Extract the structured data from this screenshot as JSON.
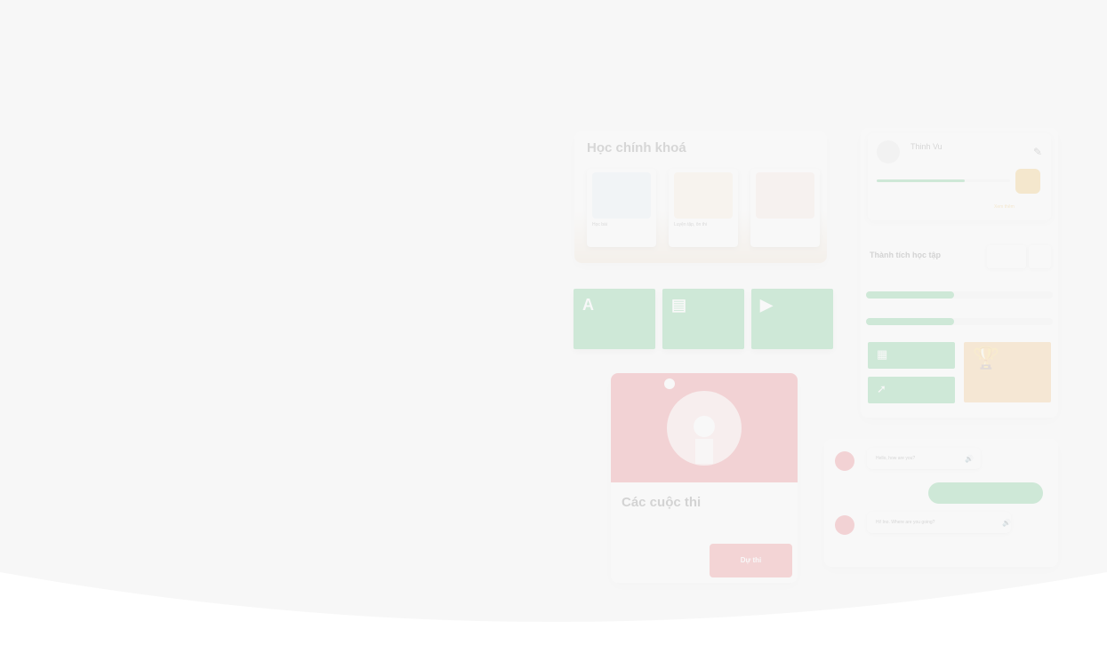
{
  "course": {
    "title": "Học chính khoá",
    "tiles": [
      {
        "label": "Học bài"
      },
      {
        "label": "Luyện tập, ôn thi"
      },
      {
        "label": ""
      }
    ]
  },
  "contest": {
    "title": "Các cuộc thi",
    "subtitle": "",
    "button": "Dự thi"
  },
  "profile": {
    "name": "Thinh Vu",
    "view_all": "Xem thêm"
  },
  "achievements": {
    "title": "Thành tích học tập"
  },
  "chat": {
    "bot_name": "",
    "q1": "Hello, how are you?",
    "answer": "",
    "q2": "Hi! Ino. Where are you going?"
  },
  "colors": {
    "green": "#1aa64a",
    "red": "#e0323a",
    "orange": "#f1a43a",
    "background": "#f7f7f7"
  },
  "icons": [
    "translate-icon",
    "chat-icon",
    "play-icon",
    "pencil-icon",
    "trophy-icon",
    "speaker-icon",
    "robot-icon"
  ]
}
